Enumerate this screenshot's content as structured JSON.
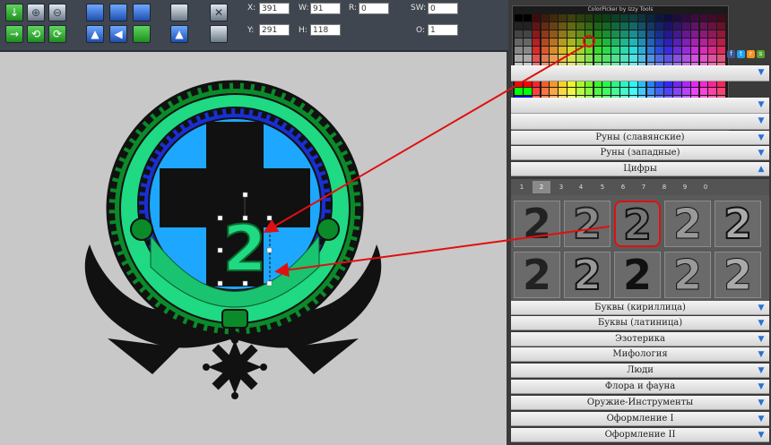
{
  "properties": {
    "x_label": "X:",
    "x_value": "391",
    "w_label": "W:",
    "w_value": "91",
    "r_label": "R:",
    "r_value": "0",
    "sw_label": "SW:",
    "sw_value": "0",
    "y_label": "Y:",
    "y_value": "291",
    "h_label": "H:",
    "h_value": "118",
    "o_label": "O:",
    "o_value": "1"
  },
  "colorpicker": {
    "title": "ColorPicker by Izzy Tools"
  },
  "categories_top": [
    {
      "label": "Руны (славянские)"
    },
    {
      "label": "Руны (западные)"
    },
    {
      "label": "Цифры"
    }
  ],
  "digit_tabs": [
    "1",
    "2",
    "3",
    "4",
    "5",
    "6",
    "7",
    "8",
    "9",
    "0"
  ],
  "digit_thumbs": [
    "2",
    "2",
    "2",
    "2",
    "2",
    "2",
    "2",
    "2",
    "2",
    "2"
  ],
  "categories_bottom": [
    {
      "label": "Буквы (кириллица)"
    },
    {
      "label": "Буквы (латиница)"
    },
    {
      "label": "Эзотерика"
    },
    {
      "label": "Мифология"
    },
    {
      "label": "Люди"
    },
    {
      "label": "Флора и фауна"
    },
    {
      "label": "Оружие-Инструменты"
    },
    {
      "label": "Оформление I"
    },
    {
      "label": "Оформление II"
    }
  ],
  "canvas": {
    "digit": "2"
  },
  "colors": {
    "green_ring": "#1fd983",
    "dark_green": "#0b8a2a",
    "blue_ring": "#1a2fd0",
    "cyan": "#1ea7ff",
    "arrow": "#e01010",
    "highlight": "#e01010"
  }
}
